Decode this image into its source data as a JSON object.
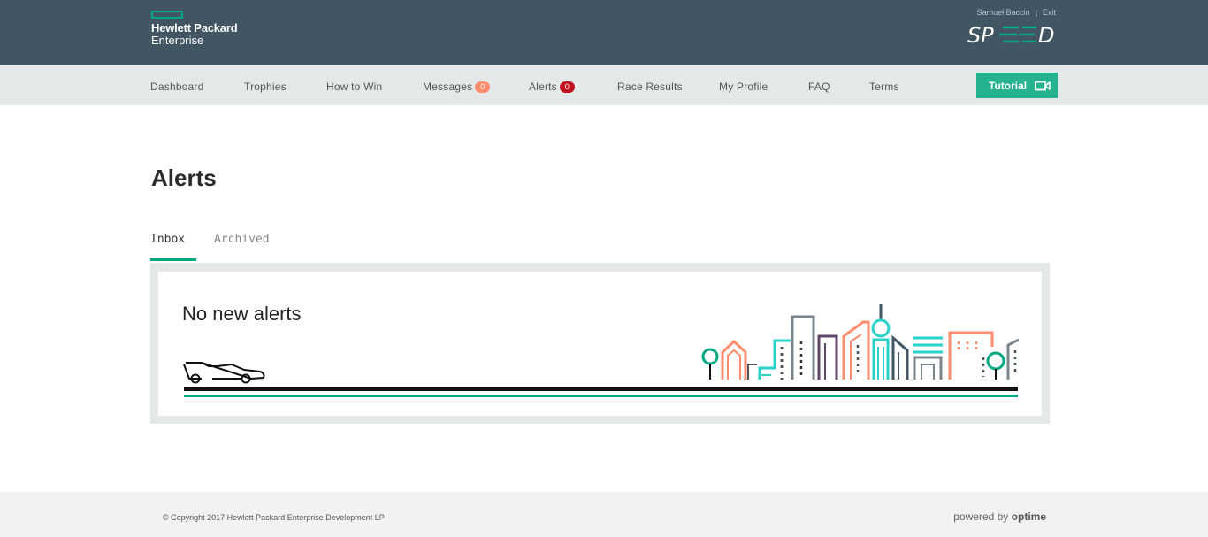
{
  "header": {
    "brand_line1": "Hewlett Packard",
    "brand_line2": "Enterprise",
    "user_name": "Samuel Baccin",
    "exit_label": "Exit",
    "app_logo_text": "SPEED"
  },
  "nav": {
    "items": [
      {
        "label": "Dashboard"
      },
      {
        "label": "Trophies"
      },
      {
        "label": "How to Win"
      },
      {
        "label": "Messages",
        "badge": "0"
      },
      {
        "label": "Alerts",
        "badge": "0"
      },
      {
        "label": "Race Results"
      },
      {
        "label": "My Profile"
      },
      {
        "label": "FAQ"
      },
      {
        "label": "Terms"
      }
    ],
    "tutorial_label": "Tutorial",
    "tutorial_icon": "video-camera-icon"
  },
  "page": {
    "title": "Alerts",
    "tabs": [
      {
        "label": "Inbox"
      },
      {
        "label": "Archived"
      }
    ],
    "active_tab": "Inbox",
    "empty_message": "No new alerts"
  },
  "footer": {
    "copyright": "© Copyright 2017 Hewlett Packard Enterprise Development LP",
    "powered_prefix": "powered by",
    "powered_brand": "optime"
  },
  "colors": {
    "header_bg": "#425563",
    "nav_bg": "#e5e8e8",
    "accent": "#01a982",
    "button": "#25b291",
    "message_badge": "#ff8d6d",
    "alert_badge": "#c1121f"
  }
}
